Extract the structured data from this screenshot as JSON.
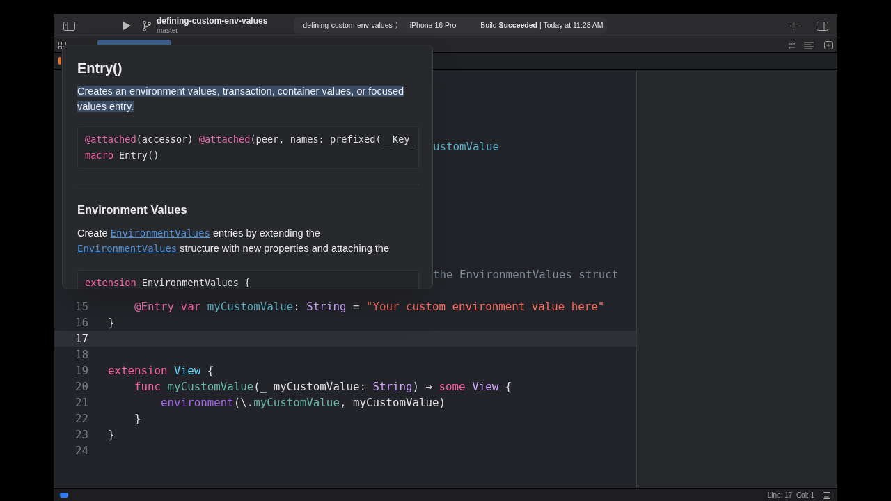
{
  "toolbar": {
    "project": "defining-custom-env-values",
    "branch": "master",
    "scheme": "defining-custom-env-values",
    "separator": "〉",
    "device": "iPhone 16 Pro",
    "status": "Build **Succeeded** | Today at 11:28 AM"
  },
  "popup": {
    "title": "Entry()",
    "summary": {
      "text": "Creates an environment values, transaction, container values, or focused values entry.",
      "highlighted": true
    },
    "declaration": [
      [
        {
          "text": "@attached",
          "kind": "attribute"
        },
        {
          "text": "(accessor) ",
          "kind": "plain"
        },
        {
          "text": "@attached",
          "kind": "attribute"
        },
        {
          "text": "(peer, names: prefixed(__Key_",
          "kind": "plain"
        }
      ],
      [
        {
          "text": "macro",
          "kind": "keyword"
        },
        {
          "text": " Entry()",
          "kind": "plain"
        }
      ]
    ],
    "section_title": "Environment Values",
    "section_text": [
      {
        "text": "Create ",
        "link": false
      },
      {
        "text": "EnvironmentValues",
        "link": true
      },
      {
        "text": " entries by extending the ",
        "link": false
      },
      {
        "text": "EnvironmentValues",
        "link": true
      },
      {
        "text": " structure with new properties and attaching the",
        "link": false
      }
    ],
    "example": [
      [
        {
          "text": "extension",
          "kind": "keyword"
        },
        {
          "text": " EnvironmentValues {",
          "kind": "plain"
        }
      ]
    ]
  },
  "editor": {
    "fragments": [
      [
        {
          "text": "ustomValue",
          "kind": "decl"
        }
      ],
      [
        {
          "text": "the EnvironmentValues struct",
          "kind": "comment"
        }
      ]
    ],
    "lines": [
      {
        "number": "15",
        "current": false,
        "tokens": [
          {
            "text": "    @Entry",
            "kind": "attribute"
          },
          {
            "text": " var ",
            "kind": "keyword"
          },
          {
            "text": "myCustomValue",
            "kind": "decl"
          },
          {
            "text": ": ",
            "kind": "plain"
          },
          {
            "text": "String",
            "kind": "type"
          },
          {
            "text": " = ",
            "kind": "plain"
          },
          {
            "text": "\"Your custom environment value here\"",
            "kind": "string"
          }
        ]
      },
      {
        "number": "16",
        "current": false,
        "tokens": [
          {
            "text": "}",
            "kind": "plain"
          }
        ]
      },
      {
        "number": "17",
        "current": true
      },
      {
        "number": "18",
        "current": false
      },
      {
        "number": "19",
        "current": false,
        "tokens": [
          {
            "text": "extension ",
            "kind": "keyword"
          },
          {
            "text": "View",
            "kind": "typedecl"
          },
          {
            "text": " {",
            "kind": "plain"
          }
        ]
      },
      {
        "number": "20",
        "current": false,
        "tokens": [
          {
            "text": "    func ",
            "kind": "keyword"
          },
          {
            "text": "myCustomValue",
            "kind": "member"
          },
          {
            "text": "(_ myCustomValue: ",
            "kind": "plain"
          },
          {
            "text": "String",
            "kind": "type"
          },
          {
            "text": ") → ",
            "kind": "plain"
          },
          {
            "text": "some ",
            "kind": "keyword"
          },
          {
            "text": "View",
            "kind": "type"
          },
          {
            "text": " {",
            "kind": "plain"
          }
        ]
      },
      {
        "number": "21",
        "current": false,
        "tokens": [
          {
            "text": "        environment",
            "kind": "func"
          },
          {
            "text": "(\\.",
            "kind": "plain"
          },
          {
            "text": "myCustomValue",
            "kind": "member"
          },
          {
            "text": ", myCustomValue)",
            "kind": "plain"
          }
        ]
      },
      {
        "number": "22",
        "current": false,
        "tokens": [
          {
            "text": "    }",
            "kind": "plain"
          }
        ]
      },
      {
        "number": "23",
        "current": false,
        "tokens": [
          {
            "text": "}",
            "kind": "plain"
          }
        ]
      },
      {
        "number": "24",
        "current": false
      }
    ]
  },
  "status_bar": {
    "position": "Line: 17  Col: 1"
  }
}
